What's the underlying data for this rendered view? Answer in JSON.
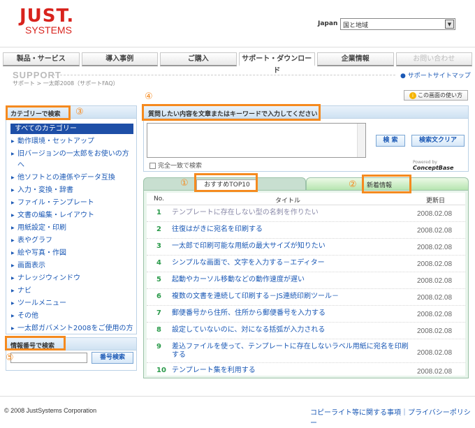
{
  "header": {
    "logo_main": "JUST",
    "logo_dot": ".",
    "logo_sub": "SYSTEMS",
    "country_label": "Japan",
    "region_value": "国と地域"
  },
  "nav": {
    "tabs": [
      {
        "label": "製品・サービス"
      },
      {
        "label": "導入事例"
      },
      {
        "label": "ご購入"
      },
      {
        "label": "サポート・ダウンロード"
      },
      {
        "label": "企業情報"
      },
      {
        "label": "お問い合わせ"
      }
    ]
  },
  "support": {
    "title": "SUPPORT",
    "breadcrumb": "サポート > 一太郎2008（サポートFAQ）",
    "sitemap": "サポートサイトマップ",
    "howto_icon": "i",
    "howto": "この画面の使い方"
  },
  "annotations": {
    "n1": "①",
    "n2": "②",
    "n3": "③",
    "n4": "④",
    "n5": "⑤"
  },
  "category": {
    "heading": "カテゴリーで検索",
    "all": "すべてのカテゴリー",
    "items": [
      "動作環境・セットアップ",
      "旧バージョンの一太郎をお使いの方へ",
      "他ソフトとの連係やデータ互換",
      "入力・変換・辞書",
      "ファイル・テンプレート",
      "文書の編集・レイアウト",
      "用紙設定・印刷",
      "表やグラフ",
      "絵や写真・作図",
      "画面表示",
      "ナレッジウィンドウ",
      "ナビ",
      "ツールメニュー",
      "その他",
      "一太郎ガバメント2008をご使用の方へ"
    ]
  },
  "number_search": {
    "heading": "情報番号で検索",
    "button": "番号検索"
  },
  "search": {
    "heading": "質問したい内容を文章またはキーワードで入力してください",
    "search_button": "検 索",
    "clear_button": "検索文クリア",
    "exact_label": "完全一致で検索",
    "powered_by": "Powered by",
    "powered_brand": "ConceptBase"
  },
  "tabs": {
    "top10": "おすすめTOP10",
    "new": "新着情報"
  },
  "list": {
    "col_no": "No.",
    "col_title": "タイトル",
    "col_date": "更新日",
    "rows": [
      {
        "no": "1",
        "title": "テンプレートに存在しない型の名刺を作りたい",
        "date": "2008.02.08"
      },
      {
        "no": "2",
        "title": "往復はがきに宛名を印刷する",
        "date": "2008.02.08"
      },
      {
        "no": "3",
        "title": "一太郎で印刷可能な用紙の最大サイズが知りたい",
        "date": "2008.02.08"
      },
      {
        "no": "4",
        "title": "シンプルな画面で、文字を入力する－エディター",
        "date": "2008.02.08"
      },
      {
        "no": "5",
        "title": "起動やカーソル移動などの動作速度が遅い",
        "date": "2008.02.08"
      },
      {
        "no": "6",
        "title": "複数の文書を連続して印刷する－JS連続印刷ツール－",
        "date": "2008.02.08"
      },
      {
        "no": "7",
        "title": "郵便番号から住所、住所から郵便番号を入力する",
        "date": "2008.02.08"
      },
      {
        "no": "8",
        "title": "設定していないのに、対になる括弧が入力される",
        "date": "2008.02.08"
      },
      {
        "no": "9",
        "title": "差込ファイルを使って、テンプレートに存在しないラベル用紙に宛名を印刷する",
        "date": "2008.02.08"
      },
      {
        "no": "10",
        "title": "テンプレート集を利用する",
        "date": "2008.02.08"
      }
    ]
  },
  "footer": {
    "copyright": "© 2008 JustSystems Corporation",
    "links": "コピーライト等に関する事項｜プライバシーポリシー"
  },
  "colors": {
    "brand_red": "#d8231d",
    "link_blue": "#1a58b5",
    "annotation_orange": "#f58a1f",
    "selected_blue": "#1e4fa7",
    "row_number_green": "#2a9a4a"
  }
}
